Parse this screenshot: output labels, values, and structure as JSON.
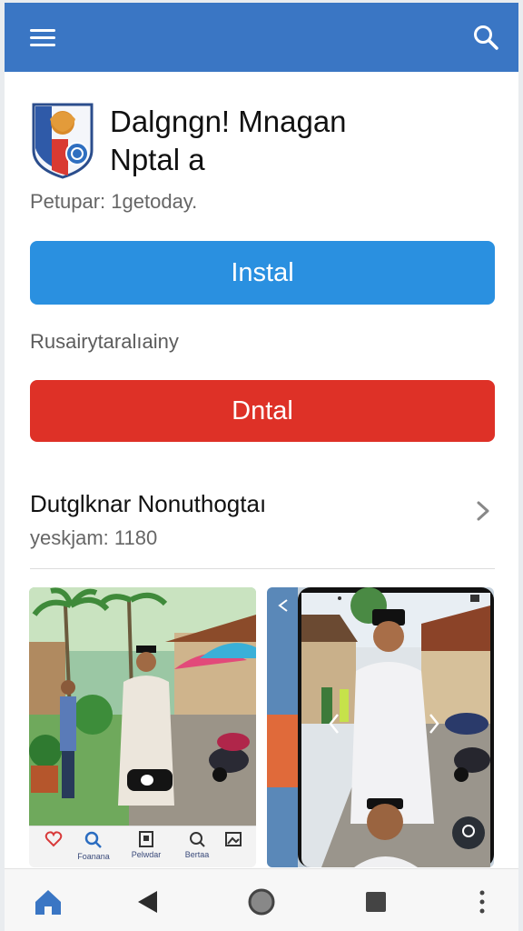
{
  "app": {
    "title_line1": "Dalgngn! Mnagan",
    "title_line2": "Nptal a",
    "subtitle": "Petupar: 1getoday."
  },
  "buttons": {
    "install": "Instal",
    "uninstall": "Dntal"
  },
  "info_line": "Rusairytaralıainy",
  "section": {
    "title": "Dutglknar Nonuthogtaı",
    "meta": "yeskjam: 1180"
  },
  "mini_nav": {
    "labels": [
      "Foanana",
      "Pelwdar",
      "Bertaa"
    ]
  },
  "icons": {
    "topbar_menu": "hamburger-icon",
    "topbar_search": "search-icon",
    "app_icon": "shield-emblem-icon",
    "chevron": "chevron-right-icon",
    "bottom_nav": [
      "home-icon",
      "back-icon",
      "circle-home-icon",
      "square-recents-icon",
      "more-vertical-icon"
    ]
  },
  "colors": {
    "topbar": "#3a76c4",
    "install_button": "#2a90e0",
    "uninstall_button": "#de3127",
    "home_icon_active": "#3a76c4"
  }
}
